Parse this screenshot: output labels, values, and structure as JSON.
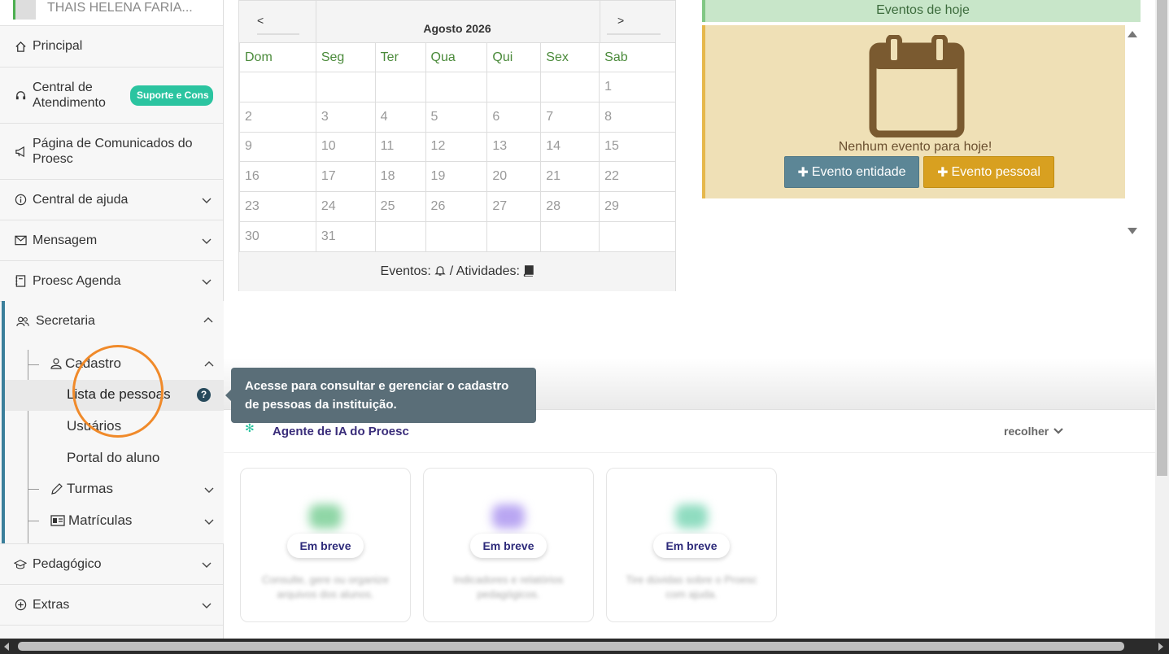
{
  "user": {
    "name": "THAIS HELENA FARIA..."
  },
  "sidebar": {
    "items": [
      {
        "label": "Principal",
        "icon": "home-icon"
      },
      {
        "label": "Central de Atendimento",
        "line1": "Central de",
        "line2": "Atendimento",
        "badge": "Suporte e Cons",
        "icon": "headset-icon"
      },
      {
        "label": "Página de Comunicados do Proesc",
        "line1": "Página de Comunicados do",
        "line2": "Proesc",
        "icon": "megaphone-icon"
      },
      {
        "label": "Central de ajuda",
        "icon": "info-icon"
      },
      {
        "label": "Mensagem",
        "icon": "envelope-icon"
      },
      {
        "label": "Proesc Agenda",
        "icon": "agenda-icon"
      },
      {
        "label": "Secretaria",
        "icon": "people-icon"
      },
      {
        "label": "Pedagógico",
        "icon": "graduation-cap-icon"
      },
      {
        "label": "Extras",
        "icon": "plus-circle-icon"
      }
    ],
    "secretaria": {
      "cadastro": "Cadastro",
      "lista": "Lista de pessoas",
      "usuarios": "Usuários",
      "portal": "Portal do aluno",
      "turmas": "Turmas",
      "matriculas": "Matrículas"
    }
  },
  "calendar": {
    "prev": "<",
    "next": ">",
    "title": "Agosto 2026",
    "weekdays": [
      "Dom",
      "Seg",
      "Ter",
      "Qua",
      "Qui",
      "Sex",
      "Sab"
    ],
    "weeks": [
      [
        "",
        "",
        "",
        "",
        "",
        "",
        "1"
      ],
      [
        "2",
        "3",
        "4",
        "5",
        "6",
        "7",
        "8"
      ],
      [
        "9",
        "10",
        "11",
        "12",
        "13",
        "14",
        "15"
      ],
      [
        "16",
        "17",
        "18",
        "19",
        "20",
        "21",
        "22"
      ],
      [
        "23",
        "24",
        "25",
        "26",
        "27",
        "28",
        "29"
      ],
      [
        "30",
        "31",
        "",
        "",
        "",
        "",
        ""
      ]
    ],
    "footer_events": "Eventos:",
    "footer_activities": "/ Atividades:"
  },
  "events": {
    "header": "Eventos de hoje",
    "empty": "Nenhum evento para hoje!",
    "btn_entity": "Evento entidade",
    "btn_personal": "Evento pessoal"
  },
  "tooltip": {
    "text": "Acesse para consultar e gerenciar o cadastro de pessoas da instituição."
  },
  "ai": {
    "title": "Agente de IA do Proesc",
    "collapse": "recolher",
    "cards": [
      {
        "pill": "Em breve",
        "text": "Consulte, gere ou organize arquivos dos alunos."
      },
      {
        "pill": "Em breve",
        "text": "Indicadores e relatórios pedagógicos."
      },
      {
        "pill": "Em breve",
        "text": "Tire dúvidas sobre o Proesc com ajuda."
      }
    ]
  },
  "colors": {
    "accent_green": "#2bc4a0",
    "secretaria_bar": "#3b7f9b",
    "highlight": "#f08a2a",
    "btn_blue": "#5c8696",
    "btn_gold": "#d8a020"
  }
}
